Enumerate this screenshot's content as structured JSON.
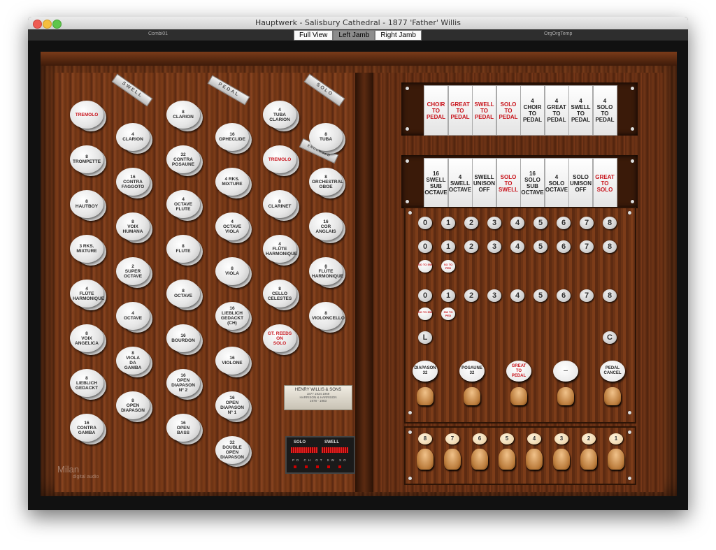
{
  "window": {
    "title": "Hauptwerk - Salisbury Cathedral - 1877 'Father' Willis"
  },
  "toolbar": {
    "left_label": "Combi01",
    "right_label": "OrgOrgTemp",
    "tabs": [
      {
        "label": "Full View",
        "active": false
      },
      {
        "label": "Left Jamb",
        "active": true
      },
      {
        "label": "Right Jamb",
        "active": false
      }
    ]
  },
  "plaques": {
    "swell": "SWELL",
    "pedal": "PEDAL",
    "solo": "SOLO",
    "enclosed": "ENCLOSED"
  },
  "maker_plate": {
    "line1": "HENRY WILLIS & SONS",
    "line2": "1877   1934   1969",
    "line3": "HARRISON & HARRISON",
    "line4": "1978 - 1983"
  },
  "meter": {
    "left": "SOLO",
    "right": "SWELL",
    "divisions": "PD CH GT SW SO"
  },
  "brand": {
    "name": "Milan",
    "sub": "digital audio"
  },
  "swell_stops": [
    {
      "label": "TREMOLO",
      "red": true
    },
    {
      "label": "8\nTROMPETTE",
      "red": false
    },
    {
      "label": "8\nHAUTBOY",
      "red": false
    },
    {
      "label": "3 RKS.\nMIXTURE",
      "red": false
    },
    {
      "label": "4\nFLÛTE\nHARMONIQUE",
      "red": false
    },
    {
      "label": "8\nVOIX\nANGELICA",
      "red": false
    },
    {
      "label": "8\nLIEBLICH\nGEDACKT",
      "red": false
    },
    {
      "label": "16\nCONTRA\nGAMBA",
      "red": false
    }
  ],
  "swell_stops_2": [
    {
      "label": "4\nCLARION",
      "red": false
    },
    {
      "label": "16\nCONTRA\nFAGGOTO",
      "red": false
    },
    {
      "label": "8\nVOIX\nHUMANA",
      "red": false
    },
    {
      "label": "2\nSUPER\nOCTAVE",
      "red": false
    },
    {
      "label": "4\nOCTAVE",
      "red": false
    },
    {
      "label": "8\nVIOLA\nDA\nGAMBA",
      "red": false
    },
    {
      "label": "8\nOPEN\nDIAPASON",
      "red": false
    }
  ],
  "pedal_stops": [
    {
      "label": "8\nCLARION",
      "red": false
    },
    {
      "label": "32\nCONTRA\nPOSAUNE",
      "red": false
    },
    {
      "label": "4\nOCTAVE\nFLUTE",
      "red": false
    },
    {
      "label": "8\nFLUTE",
      "red": false
    },
    {
      "label": "8\nOCTAVE",
      "red": false
    },
    {
      "label": "16\nBOURDON",
      "red": false
    },
    {
      "label": "16\nOPEN\nDIAPASON\nNº 2",
      "red": false
    },
    {
      "label": "16\nOPEN\nBASS",
      "red": false
    }
  ],
  "pedal_stops_2": [
    {
      "label": "16\nOPHECLIDE",
      "red": false
    },
    {
      "label": "4 RKS.\nMIXTURE",
      "red": false
    },
    {
      "label": "4\nOCTAVE\nVIOLA",
      "red": false
    },
    {
      "label": "8\nVIOLA",
      "red": false
    },
    {
      "label": "16\nLIEBLICH\nGEDACKT\n(CH)",
      "red": false
    },
    {
      "label": "16\nVIOLONE",
      "red": false
    },
    {
      "label": "16\nOPEN\nDIAPASON\nNº 1",
      "red": false
    },
    {
      "label": "32\nDOUBLE\nOPEN\nDIAPASON",
      "red": false
    }
  ],
  "solo_stops": [
    {
      "label": "4\nTUBA\nCLARION",
      "red": false
    },
    {
      "label": "TREMOLO",
      "red": true
    },
    {
      "label": "8\nCLARINET",
      "red": false
    },
    {
      "label": "4\nFLÛTE\nHARMONIQUE",
      "red": false
    },
    {
      "label": "8\nCELLO\nCELESTES",
      "red": false
    },
    {
      "label": "GT. REEDS\nON\nSOLO",
      "red": true
    }
  ],
  "solo_stops_2": [
    {
      "label": "8\nTUBA",
      "red": false
    },
    {
      "label": "8\nORCHESTRAL\nOBOE",
      "red": false
    },
    {
      "label": "16\nCOR\nANGLAIS",
      "red": false
    },
    {
      "label": "8\nFLÛTE\nHARMONIQUE",
      "red": false
    },
    {
      "label": "8\nVIOLONCELLO",
      "red": false
    }
  ],
  "couplers_row1": [
    {
      "label": "CHOIR\nTO\nPEDAL",
      "red": true
    },
    {
      "label": "GREAT\nTO\nPEDAL",
      "red": true
    },
    {
      "label": "SWELL\nTO\nPEDAL",
      "red": true
    },
    {
      "label": "SOLO\nTO\nPEDAL",
      "red": true
    },
    {
      "label": "4\nCHOIR\nTO\nPEDAL",
      "red": false
    },
    {
      "label": "4\nGREAT\nTO\nPEDAL",
      "red": false
    },
    {
      "label": "4\nSWELL\nTO\nPEDAL",
      "red": false
    },
    {
      "label": "4\nSOLO\nTO\nPEDAL",
      "red": false
    }
  ],
  "couplers_row2": [
    {
      "label": "16\nSWELL\nSUB\nOCTAVE",
      "red": false
    },
    {
      "label": "4\nSWELL\nOCTAVE",
      "red": false
    },
    {
      "label": "SWELL\nUNISON\nOFF",
      "red": false
    },
    {
      "label": "SOLO\nTO\nSWELL",
      "red": true
    },
    {
      "label": "16\nSOLO\nSUB\nOCTAVE",
      "red": false
    },
    {
      "label": "4\nSOLO\nOCTAVE",
      "red": false
    },
    {
      "label": "SOLO\nUNISON\nOFF",
      "red": false
    },
    {
      "label": "GREAT\nTO\nSOLO",
      "red": true
    }
  ],
  "piston_row": [
    "0",
    "1",
    "2",
    "3",
    "4",
    "5",
    "6",
    "7",
    "8"
  ],
  "mini_row2": [
    "SO\nTO\nSW",
    "SO\nTO\nPED"
  ],
  "mini_row3": [
    "SO\nTO\nSW",
    "SW\nTO\nPED"
  ],
  "cap_left": "L",
  "cap_right": "C",
  "toe_studs": [
    {
      "label": "DIAPASON\n32",
      "red": false
    },
    {
      "label": "POSAUNE\n32",
      "red": false
    },
    {
      "label": "GREAT\nTO\nPEDAL",
      "red": true
    },
    {
      "label": "—",
      "red": false
    },
    {
      "label": "PEDAL\nCANCEL",
      "red": false
    }
  ],
  "toe_pistons": [
    "8",
    "7",
    "6",
    "5",
    "4",
    "3",
    "2",
    "1"
  ]
}
